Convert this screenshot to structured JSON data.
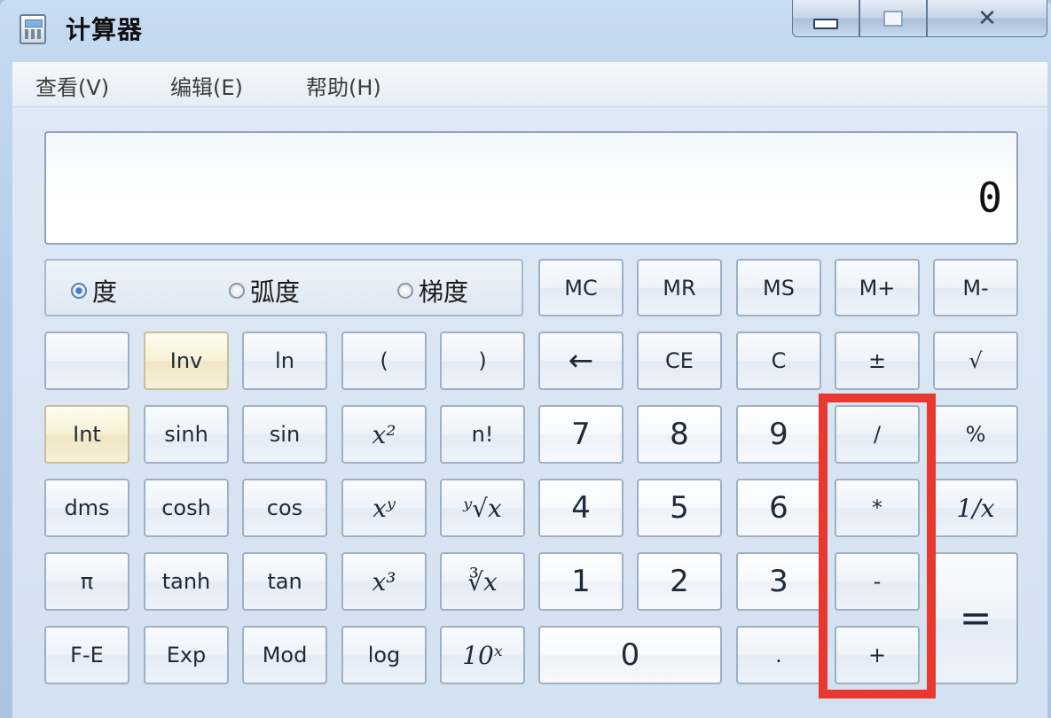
{
  "window": {
    "title": "计算器",
    "controls": {
      "close_glyph": "✕"
    }
  },
  "menu": [
    "查看(V)",
    "编辑(E)",
    "帮助(H)"
  ],
  "display": {
    "value": "0"
  },
  "angle_modes": {
    "options": [
      "度",
      "弧度",
      "梯度"
    ],
    "selected": "度"
  },
  "memory_keys": [
    "MC",
    "MR",
    "MS",
    "M+",
    "M-"
  ],
  "keys": {
    "row2": [
      "",
      "Inv",
      "ln",
      "(",
      ")",
      "←",
      "CE",
      "C",
      "±",
      "√"
    ],
    "row3": [
      "Int",
      "sinh",
      "sin",
      "x²",
      "n!",
      "7",
      "8",
      "9",
      "/",
      "%"
    ],
    "row4": [
      "dms",
      "cosh",
      "cos",
      "xʸ",
      "ʸ√x",
      "4",
      "5",
      "6",
      "*",
      "1/x"
    ],
    "row5": [
      "π",
      "tanh",
      "tan",
      "x³",
      "∛x",
      "1",
      "2",
      "3",
      "-",
      "="
    ],
    "row6": [
      "F-E",
      "Exp",
      "Mod",
      "log",
      "10ˣ",
      "0",
      ".",
      "+"
    ]
  },
  "annotation": {
    "color": "#e8382f",
    "target": "operator column / * - +"
  }
}
